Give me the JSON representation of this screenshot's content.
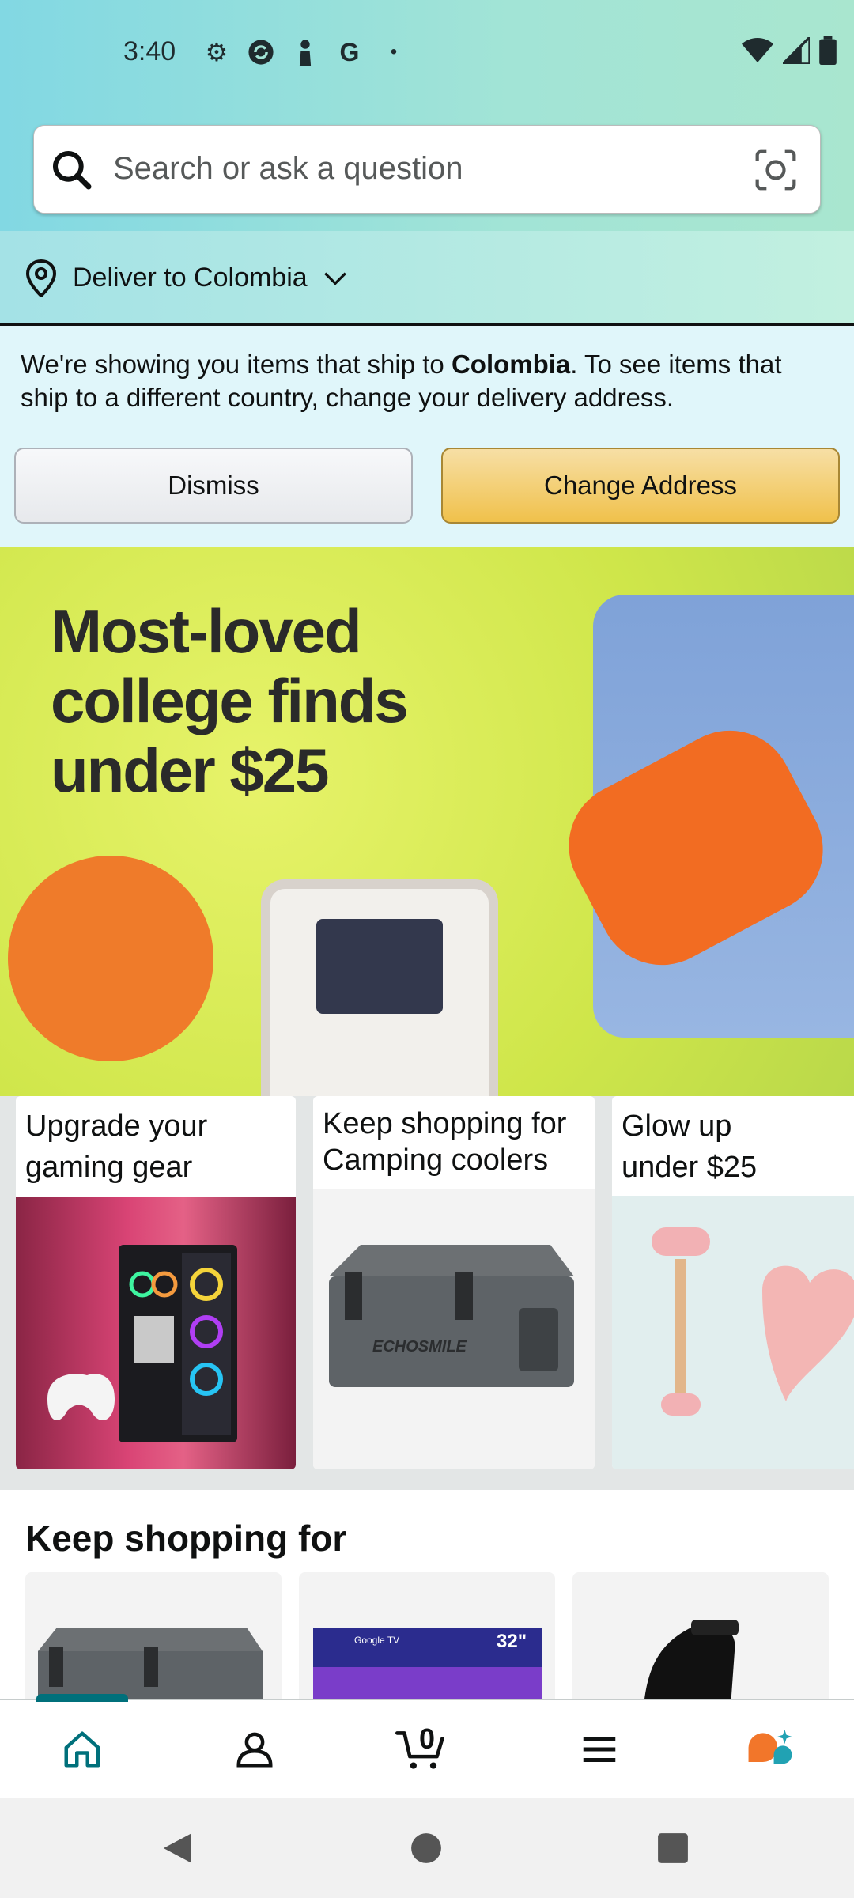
{
  "status_bar": {
    "time": "3:40"
  },
  "search": {
    "placeholder": "Search or ask a question"
  },
  "delivery": {
    "label": "Deliver to Colombia"
  },
  "notice": {
    "text_before": "We're showing you items that ship to ",
    "country": "Colombia",
    "text_after": ". To see items that ship to a different country, change your delivery address.",
    "dismiss_label": "Dismiss",
    "change_label": "Change Address"
  },
  "hero": {
    "title_line1": "Most-loved",
    "title_line2": "college finds",
    "title_line3": "under $25"
  },
  "cards": [
    {
      "title": "Upgrade your gaming gear"
    },
    {
      "title": "Keep shopping for Camping coolers",
      "brand": "ECHOSMILE"
    },
    {
      "title": "Glow up under $25"
    }
  ],
  "keep_shopping": {
    "title": "Keep shopping for",
    "tiles": [
      {
        "name": "cooler"
      },
      {
        "name": "tv",
        "badge": "32\"",
        "brand": "Google TV"
      },
      {
        "name": "skate"
      }
    ]
  },
  "bottom_nav": {
    "cart_count": "0",
    "items": [
      "home-icon",
      "account-icon",
      "cart-icon",
      "menu-icon",
      "rufus-icon"
    ]
  },
  "colors": {
    "accent": "#00707b",
    "button_yellow": "#f0c14b",
    "notice_bg": "#e0f6fa"
  }
}
